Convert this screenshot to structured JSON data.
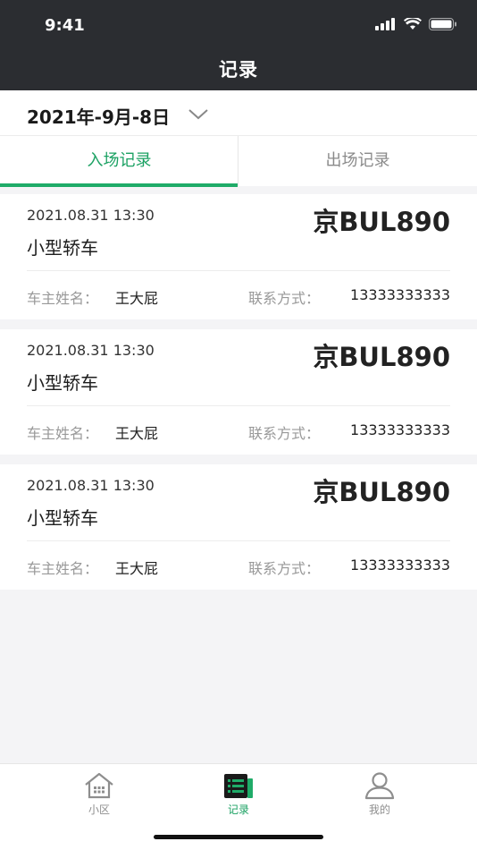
{
  "status_bar": {
    "time": "9:41"
  },
  "nav": {
    "title": "记录"
  },
  "date_filter": {
    "value": "2021年-9月-8日"
  },
  "tabs": [
    {
      "label": "入场记录",
      "active": true
    },
    {
      "label": "出场记录",
      "active": false
    }
  ],
  "records": [
    {
      "time": "2021.08.31 13:30",
      "plate": "京BUL890",
      "vehicle_type": "小型轿车",
      "owner_label": "车主姓名：",
      "owner": "王大屁",
      "phone_label": "联系方式：",
      "phone": "13333333333"
    },
    {
      "time": "2021.08.31 13:30",
      "plate": "京BUL890",
      "vehicle_type": "小型轿车",
      "owner_label": "车主姓名：",
      "owner": "王大屁",
      "phone_label": "联系方式：",
      "phone": "13333333333"
    },
    {
      "time": "2021.08.31 13:30",
      "plate": "京BUL890",
      "vehicle_type": "小型轿车",
      "owner_label": "车主姓名：",
      "owner": "王大屁",
      "phone_label": "联系方式：",
      "phone": "13333333333"
    }
  ],
  "tabbar": [
    {
      "label": "小区",
      "icon": "home-icon",
      "active": false
    },
    {
      "label": "记录",
      "icon": "records-icon",
      "active": true
    },
    {
      "label": "我的",
      "icon": "user-icon",
      "active": false
    }
  ],
  "colors": {
    "accent": "#1aa162",
    "header_bg": "#2b2d31",
    "page_bg": "#f4f4f6"
  }
}
